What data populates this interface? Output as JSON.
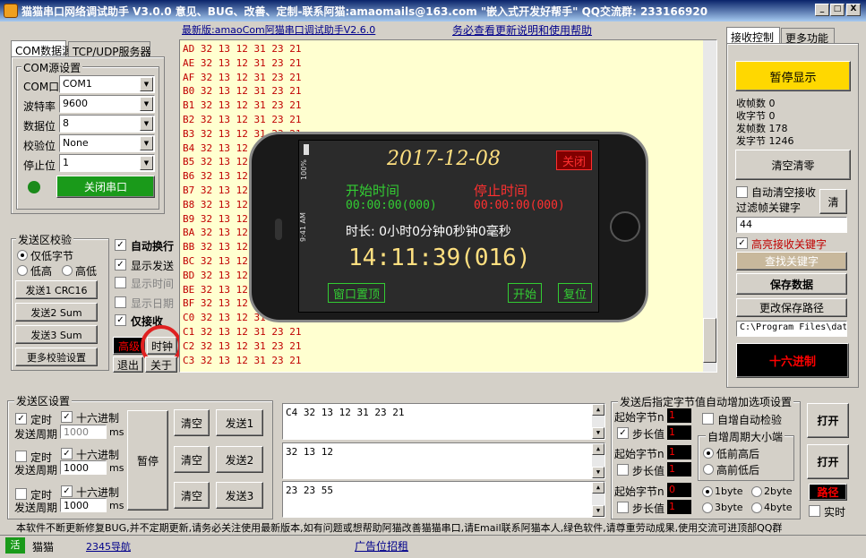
{
  "window": {
    "title": "猫猫串口网络调试助手 V3.0.0 意见、BUG、改善、定制-联系阿猫:amaomails@163.com \"嵌入式开发好帮手\" QQ交流群: 233166920",
    "min": "_",
    "max": "□",
    "close": "X"
  },
  "header": {
    "version_link": "最新版:amaoCom阿猫串口调试助手V2.6.0",
    "help_link": "务必查看更新说明和使用帮助"
  },
  "left_tabs": [
    "COM数据源",
    "TCP/UDP服务器"
  ],
  "com_settings": {
    "group_label": "COM源设置",
    "fields": [
      {
        "label": "COM口",
        "value": "COM1"
      },
      {
        "label": "波特率",
        "value": "9600"
      },
      {
        "label": "数据位",
        "value": "8"
      },
      {
        "label": "校验位",
        "value": "None"
      },
      {
        "label": "停止位",
        "value": "1"
      }
    ],
    "close_port": "关闭串口"
  },
  "checksum": {
    "group_label": "发送区校验",
    "opt_low_byte": "仅低字节",
    "opt_low_high": "低高",
    "opt_high_low": "高低",
    "buttons": [
      "发送1 CRC16",
      "发送2 Sum",
      "发送3 Sum",
      "更多校验设置"
    ]
  },
  "display_opts": {
    "items": [
      {
        "label": "自动换行",
        "checked": true,
        "bold": true
      },
      {
        "label": "显示发送",
        "checked": true,
        "bold": false
      },
      {
        "label": "显示时间",
        "checked": false,
        "bold": false
      },
      {
        "label": "显示日期",
        "checked": false,
        "bold": false
      },
      {
        "label": "仅接收",
        "checked": true,
        "bold": true
      }
    ],
    "advanced": "高级",
    "clock": "时钟",
    "exit": "退出",
    "about": "关于"
  },
  "recv_lines": [
    "AD 32 13 12 31 23 21",
    "AE 32 13 12 31 23 21",
    "AF 32 13 12 31 23 21",
    "B0 32 13 12 31 23 21",
    "B1 32 13 12 31 23 21",
    "B2 32 13 12 31 23 21",
    "B3 32 13 12 31 23 21",
    "B4 32 13 12 31 23 21",
    "B5 32 13 12 31 23 21",
    "B6 32 13 12 31 23 21",
    "B7 32 13 12 31 23 21",
    "B8 32 13 12 31 23 21",
    "B9 32 13 12 31 23 21",
    "BA 32 13 12 31 23 21",
    "BB 32 13 12 31 23 21",
    "BC 32 13 12 31 23 21",
    "BD 32 13 12 31 23 21",
    "BE 32 13 12 31 23 21",
    "BF 32 13 12 31 23 21",
    "C0 32 13 12 31 23 21",
    "C1 32 13 12 31 23 21",
    "C2 32 13 12 31 23 21",
    "C3 32 13 12 31 23 21"
  ],
  "clock_popup": {
    "date": "2017-12-08",
    "close": "关闭",
    "start_label": "开始时间",
    "start_value": "00:00:00(000)",
    "stop_label": "停止时间",
    "stop_value": "00:00:00(000)",
    "duration": "时长: 0小时0分钟0秒钟0毫秒",
    "time": "14:11:39(016)",
    "pin": "窗口置顶",
    "start_btn": "开始",
    "reset_btn": "复位",
    "status_battery": "100%",
    "status_time": "9:41 AM"
  },
  "right_tabs": [
    "接收控制",
    "更多功能"
  ],
  "recv_ctrl": {
    "pause": "暂停显示",
    "stats": [
      "收帧数 0",
      "收字节 0",
      "发帧数 178",
      "发字节 1246"
    ],
    "clear_count": "清空清零",
    "auto_clear": "自动清空接收",
    "filter_kw": "过滤帧关键字",
    "clear": "清",
    "filter_value": "44",
    "highlight": "高亮接收关键字",
    "find_kw": "查找关键字",
    "save_data": "保存数据",
    "change_path": "更改保存路径",
    "path": "C:\\Program Files\\dat",
    "hex": "十六进制"
  },
  "send_area": {
    "group_label": "发送区设置",
    "rows": [
      {
        "timed": "定时",
        "timed_checked": true,
        "hex": "十六进制",
        "hex_checked": true,
        "period_label": "发送周期",
        "period": "1000",
        "unit": "ms",
        "clear": "清空",
        "send": "发送1",
        "text": "C4 32 13 12 31 23 21"
      },
      {
        "timed": "定时",
        "timed_checked": false,
        "hex": "十六进制",
        "hex_checked": true,
        "period_label": "发送周期",
        "period": "1000",
        "unit": "ms",
        "clear": "清空",
        "send": "发送2",
        "text": "32 13 12"
      },
      {
        "timed": "定时",
        "timed_checked": false,
        "hex": "十六进制",
        "hex_checked": true,
        "period_label": "发送周期",
        "period": "1000",
        "unit": "ms",
        "clear": "清空",
        "send": "发送3",
        "text": "23 23 55"
      }
    ],
    "pause": "暂停"
  },
  "auto_inc": {
    "group_label": "发送后指定字节值自动增加选项设置",
    "rows": [
      {
        "start_label": "起始字节n",
        "start": "1",
        "step_label": "步长值",
        "step": "1",
        "step_checked": true
      },
      {
        "start_label": "起始字节n",
        "start": "1",
        "step_label": "步长值",
        "step": "1",
        "step_checked": false
      },
      {
        "start_label": "起始字节n",
        "start": "0",
        "step_label": "步长值",
        "step": "1",
        "step_checked": false
      }
    ],
    "auto_check": "自增自动检验",
    "endian_group": "自增周期大小端",
    "low_high": "低前高后",
    "high_low": "高前低后",
    "byte_opts": [
      "1byte",
      "2byte",
      "3byte",
      "4byte"
    ],
    "open1": "打开",
    "open2": "打开",
    "path": "路径",
    "realtime": "实时"
  },
  "notice": "本软件不断更新修复BUG,并不定期更新,请务必关注使用最新版本,如有问题或想帮助阿猫改善猫猫串口,请Email联系阿猫本人,绿色软件,请尊重劳动成果,使用交流可进顶部QQ群",
  "statusbar": {
    "active": "活",
    "name": "猫猫",
    "nav": "2345导航",
    "ad": "广告位招租"
  },
  "colors": {
    "recv_text": "#c00000",
    "recv_bg": "#ffffd0",
    "pause_btn": "#ffd800",
    "screen_green": "#33cc33",
    "screen_red": "#ff3030",
    "date_yellow": "#ffe080"
  }
}
